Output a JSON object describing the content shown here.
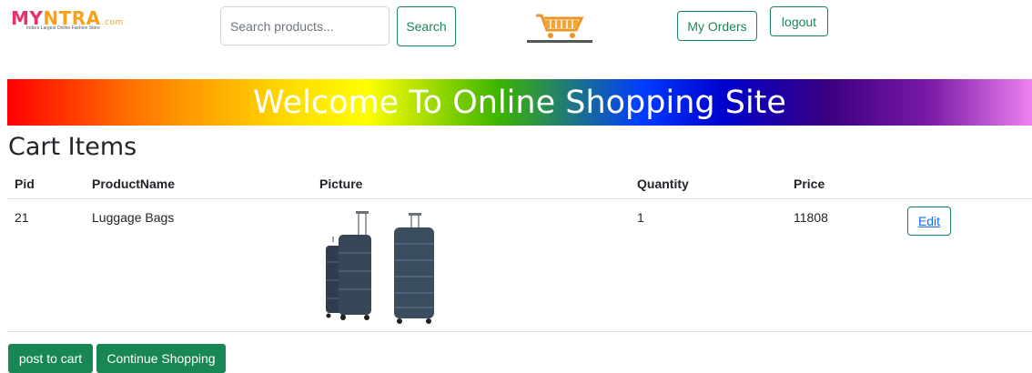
{
  "header": {
    "logo": {
      "name": "MYNTRA",
      "part1": "MY",
      "part2": "NTRA",
      "suffix": ".com",
      "tagline": "India's Largest Online Fashion Store"
    },
    "search": {
      "placeholder": "Search products...",
      "value": "",
      "button_label": "Search"
    },
    "cart_icon": "shopping-cart-icon",
    "orders_label": "My Orders",
    "logout_label": "logout"
  },
  "banner": {
    "text": "Welcome To Online Shopping Site"
  },
  "cart": {
    "title": "Cart Items",
    "columns": {
      "pid": "Pid",
      "name": "ProductName",
      "picture": "Picture",
      "quantity": "Quantity",
      "price": "Price"
    },
    "rows": [
      {
        "pid": "21",
        "name": "Luggage Bags",
        "picture": "luggage-bags-image",
        "quantity": "1",
        "price": "11808",
        "edit_label": "Edit"
      }
    ]
  },
  "actions": {
    "post_label": "post to cart",
    "continue_label": "Continue Shopping"
  },
  "colors": {
    "accent": "#198754",
    "link": "#0d6efd",
    "text": "#212529"
  }
}
